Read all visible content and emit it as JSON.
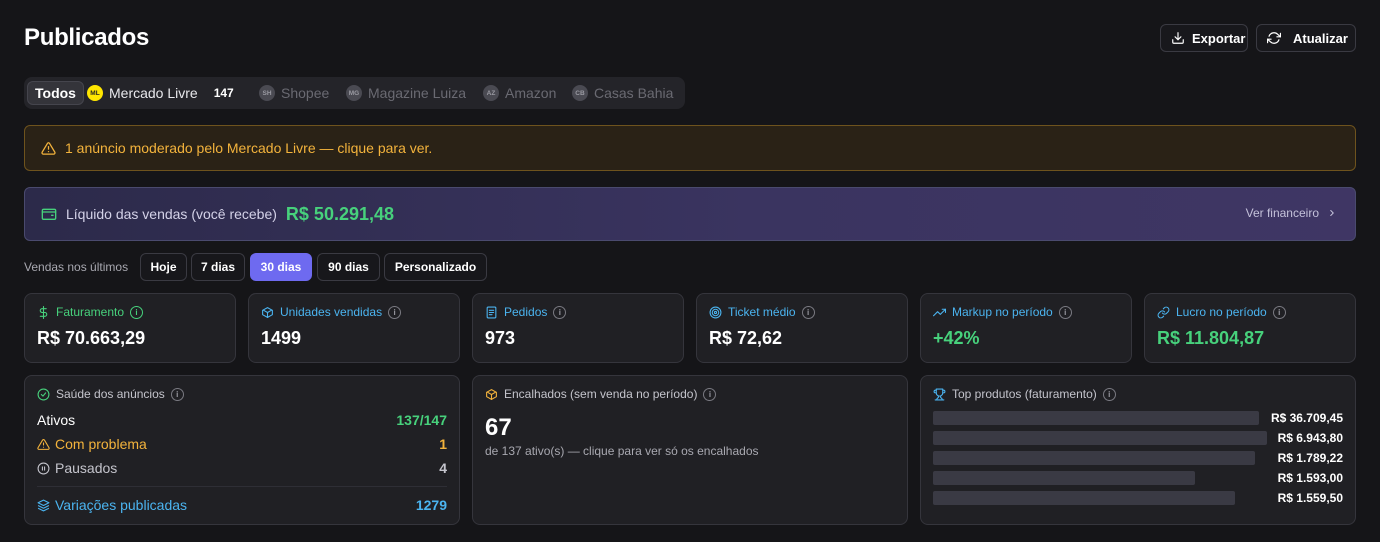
{
  "header": {
    "title": "Publicados",
    "export_label": "Exportar",
    "refresh_label": "Atualizar"
  },
  "marketplaces": {
    "todos": "Todos",
    "items": [
      {
        "badge": "ML",
        "label": "Mercado Livre",
        "count": "147"
      },
      {
        "badge": "SH",
        "label": "Shopee"
      },
      {
        "badge": "MG",
        "label": "Magazine Luiza"
      },
      {
        "badge": "AZ",
        "label": "Amazon"
      },
      {
        "badge": "CB",
        "label": "Casas Bahia"
      }
    ]
  },
  "alert": {
    "text": "1 anúncio moderado pelo Mercado Livre — clique para ver."
  },
  "liquid": {
    "label": "Líquido das vendas (você recebe)",
    "value": "R$ 50.291,48",
    "link": "Ver financeiro"
  },
  "period": {
    "label": "Vendas nos últimos",
    "options": [
      "Hoje",
      "7 dias",
      "30 dias",
      "90 dias",
      "Personalizado"
    ],
    "selected": "30 dias"
  },
  "kpis": {
    "faturamento": {
      "label": "Faturamento",
      "value": "R$ 70.663,29"
    },
    "unidades": {
      "label": "Unidades vendidas",
      "value": "1499"
    },
    "pedidos": {
      "label": "Pedidos",
      "value": "973"
    },
    "ticket": {
      "label": "Ticket médio",
      "value": "R$ 72,62"
    },
    "markup": {
      "label": "Markup no período",
      "value": "+42%"
    },
    "lucro": {
      "label": "Lucro no período",
      "value": "R$ 11.804,87"
    }
  },
  "health": {
    "title": "Saúde dos anúncios",
    "ativos_label": "Ativos",
    "ativos_value": "137/147",
    "problema_label": "Com problema",
    "problema_value": "1",
    "pausados_label": "Pausados",
    "pausados_value": "4",
    "variacoes_label": "Variações publicadas",
    "variacoes_value": "1279"
  },
  "stuck": {
    "title": "Encalhados (sem venda no período)",
    "value": "67",
    "subtitle": "de 137 ativo(s) — clique para ver só os encalhados"
  },
  "top": {
    "title": "Top produtos (faturamento)",
    "values": [
      "R$ 36.709,45",
      "R$ 6.943,80",
      "R$ 1.789,22",
      "R$ 1.593,00",
      "R$ 1.559,50"
    ]
  },
  "colors": {
    "accent": "#6e6af0",
    "green": "#47d17c",
    "blue": "#4bb4f0",
    "orange": "#f3b33c"
  },
  "icons": [
    "download-icon",
    "refresh-icon",
    "warning-icon",
    "wallet-icon",
    "chevron-right-icon",
    "dollar-icon",
    "box-icon",
    "receipt-icon",
    "target-icon",
    "trending-up-icon",
    "link-icon",
    "info-icon",
    "check-circle-icon",
    "pause-circle-icon",
    "layers-icon",
    "package-icon",
    "trophy-icon"
  ]
}
